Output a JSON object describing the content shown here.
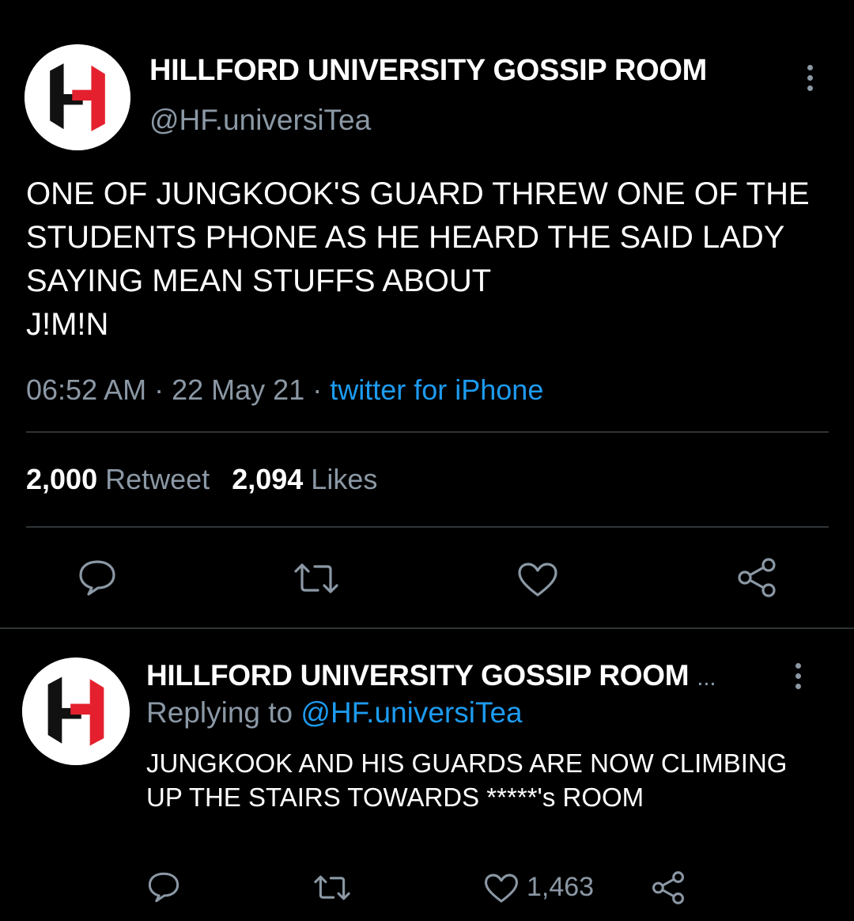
{
  "main_tweet": {
    "name": "HILLFORD UNIVERSITY GOSSIP ROOM",
    "handle": "@HF.universiTea",
    "text": "ONE OF JUNGKOOK'S GUARD THREW ONE OF THE STUDENTS PHONE AS HE HEARD THE SAID LADY SAYING MEAN STUFFS ABOUT\n J!M!N",
    "time": "06:52 AM",
    "sep1": " · ",
    "date": "22 May 21",
    "sep2": " · ",
    "source": "twitter for iPhone",
    "retweet_count": "2,000",
    "retweet_label": "Retweet",
    "like_count": "2,094",
    "like_label": "Likes",
    "actions": [
      "reply-icon",
      "retweet-icon",
      "like-icon",
      "share-icon"
    ]
  },
  "reply_tweet": {
    "name": "HILLFORD UNIVERSITY GOSSIP ROOM",
    "name_ellipsis": "...",
    "replying_prefix": "Replying to ",
    "replying_handle": "@HF.universiTea",
    "text": "JUNGKOOK AND HIS GUARDS ARE NOW CLIMBING UP THE STAIRS TOWARDS *****'s ROOM",
    "like_count": "1,463",
    "actions": [
      "reply-icon",
      "retweet-icon",
      "like-icon",
      "share-icon"
    ]
  },
  "colors": {
    "background": "#000000",
    "text": "#ffffff",
    "secondary": "#8b98a5",
    "link": "#1d9bf0",
    "logo_red": "#e5202e",
    "logo_black": "#111111"
  }
}
